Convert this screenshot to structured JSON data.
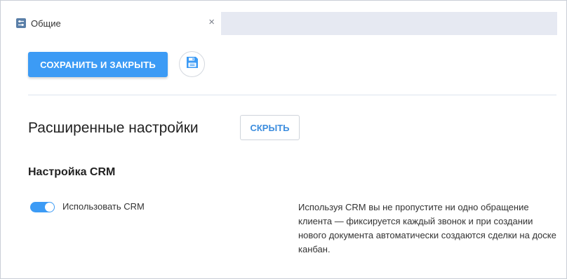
{
  "tabs": [
    {
      "label": "Общие",
      "icon": "settings-sliders-icon",
      "close": "×"
    }
  ],
  "toolbar": {
    "save_close_label": "СОХРАНИТЬ И ЗАКРЫТЬ",
    "save_icon": "floppy-disk-icon"
  },
  "section": {
    "title": "Расширенные настройки",
    "toggle_visibility_label": "СКРЫТЬ"
  },
  "crm": {
    "title": "Настройка CRM",
    "toggle_label": "Использовать CRM",
    "toggle_on": true,
    "description": "Используя CRM вы не пропустите ни одно обращение клиента — фиксируется каждый звонок и при создании нового документа автоматически создаются сделки на доске канбан."
  },
  "colors": {
    "accent": "#3c9bf5",
    "tab_empty_bg": "#e6e9f2",
    "link": "#3c8dde"
  }
}
